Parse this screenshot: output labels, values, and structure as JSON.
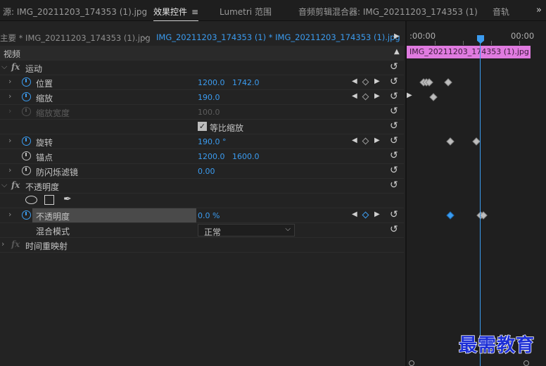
{
  "tabs": [
    {
      "label": "源: IMG_20211203_174353 (1).jpg"
    },
    {
      "label": "效果控件"
    },
    {
      "label": "Lumetri 范围"
    },
    {
      "label": "音频剪辑混合器: IMG_20211203_174353 (1)"
    },
    {
      "label": "音轨"
    }
  ],
  "clip_bar": {
    "master": "主要 * IMG_20211203_174353 (1).jpg",
    "sequence": "IMG_20211203_174353 (1) * IMG_20211203_174353 (1).jpg"
  },
  "section_video": "视频",
  "motion": {
    "title": "运动",
    "position": {
      "label": "位置",
      "x": "1200.0",
      "y": "1742.0"
    },
    "scale": {
      "label": "缩放",
      "value": "190.0"
    },
    "scale_width": {
      "label": "缩放宽度",
      "value": "100.0"
    },
    "uniform_scale": {
      "label": "等比缩放",
      "checked": true
    },
    "rotation": {
      "label": "旋转",
      "value": "190.0 °"
    },
    "anchor": {
      "label": "锚点",
      "x": "1200.0",
      "y": "1600.0"
    },
    "anti_flicker": {
      "label": "防闪烁滤镜",
      "value": "0.00"
    }
  },
  "opacity": {
    "title": "不透明度",
    "opacity_param": {
      "label": "不透明度",
      "value": "0.0 %"
    },
    "blend_mode": {
      "label": "混合模式",
      "value": "正常"
    }
  },
  "time_remap": {
    "title": "时间重映射"
  },
  "timeline": {
    "time_start": ":00:00",
    "time_end": "00:00",
    "clip_name": "IMG_20211203_174353 (1).jpg"
  },
  "watermark": "最需教育",
  "colors": {
    "accent": "#3b9cf0",
    "clip": "#e07be0",
    "background": "#232323"
  }
}
